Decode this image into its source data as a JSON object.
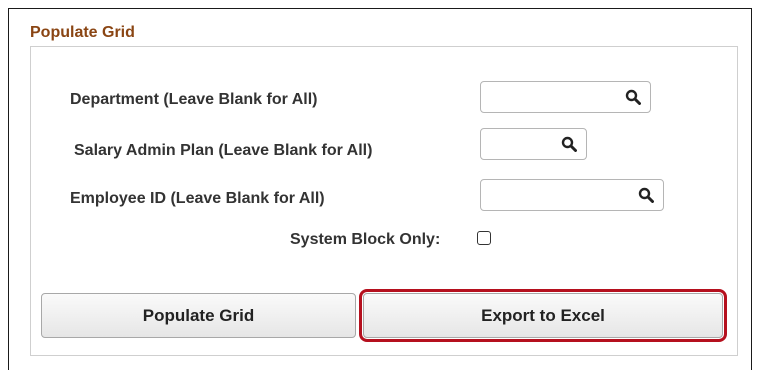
{
  "section": {
    "title": "Populate Grid"
  },
  "fields": {
    "department": {
      "label": "Department (Leave Blank for All)",
      "value": "",
      "lookup_icon": "search-icon"
    },
    "salary_admin_plan": {
      "label": "Salary Admin Plan (Leave Blank for All)",
      "value": "",
      "lookup_icon": "search-icon"
    },
    "employee_id": {
      "label": "Employee ID (Leave Blank for All)",
      "value": "",
      "lookup_icon": "search-icon"
    },
    "system_block_only": {
      "label": "System Block Only:",
      "checked": false
    }
  },
  "buttons": {
    "populate_grid": "Populate Grid",
    "export_to_excel": "Export to Excel"
  },
  "colors": {
    "section_title": "#8a4513",
    "highlight_border": "#b5101e"
  }
}
